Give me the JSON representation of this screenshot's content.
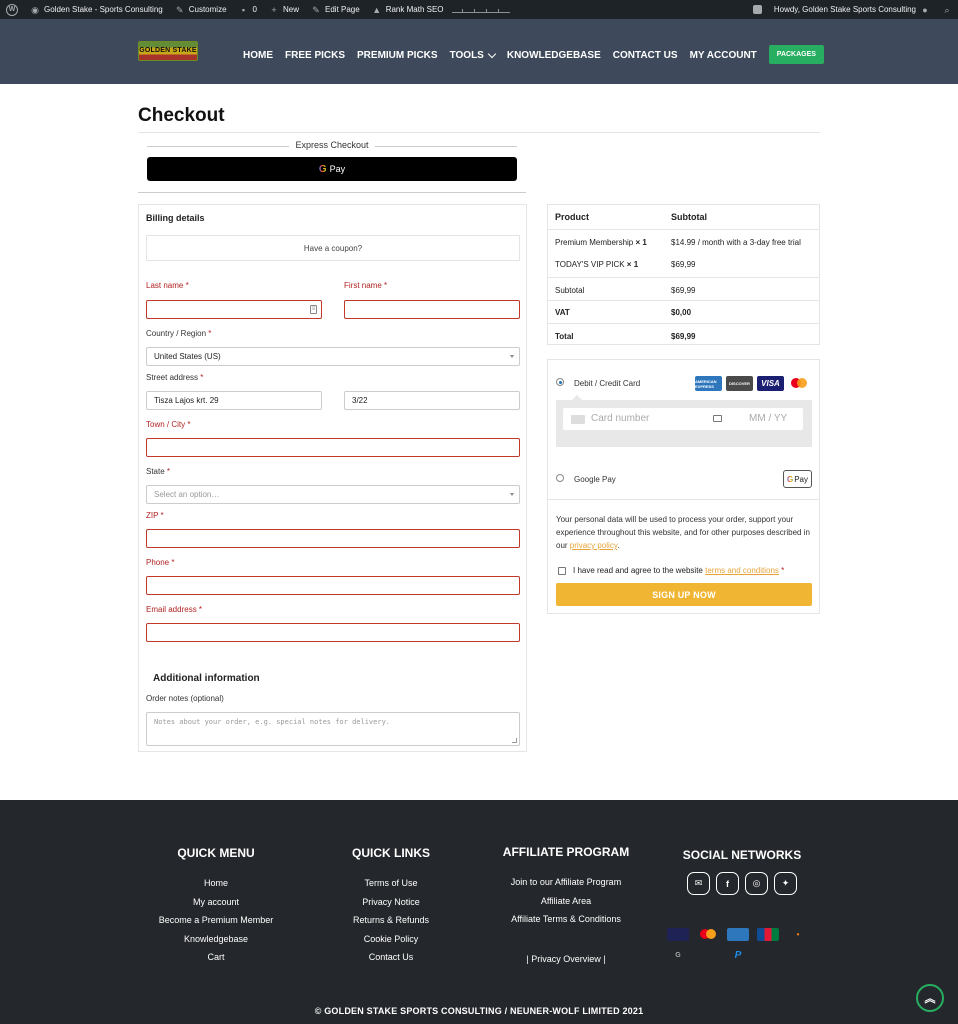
{
  "admin_bar": {
    "site_name": "Golden Stake - Sports Consulting",
    "customize": "Customize",
    "comments_count": "0",
    "new": "New",
    "edit_page": "Edit Page",
    "rank_math": "Rank Math SEO",
    "howdy": "Howdy, Golden Stake Sports Consulting"
  },
  "header": {
    "logo_text": "GOLDEN STAKE",
    "nav": [
      "HOME",
      "FREE PICKS",
      "PREMIUM PICKS",
      "TOOLS",
      "KNOWLEDGEBASE",
      "CONTACT US",
      "MY ACCOUNT"
    ],
    "packages": "PACKAGES"
  },
  "page": {
    "title": "Checkout",
    "express_checkout": "Express Checkout",
    "gpay_label": "Pay",
    "gpay_g": "G"
  },
  "billing": {
    "title": "Billing details",
    "coupon": "Have a coupon?",
    "req": "*",
    "last_name": "Last name",
    "first_name": "First name",
    "country_label": "Country / Region",
    "country_value": "United States (US)",
    "street_label": "Street address",
    "street_value": "Tisza Lajos krt. 29",
    "street2_value": "3/22",
    "city_label": "Town / City",
    "state_label": "State",
    "state_placeholder": "Select an option…",
    "zip_label": "ZIP",
    "phone_label": "Phone",
    "email_label": "Email address",
    "additional_title": "Additional information",
    "notes_label": "Order notes (optional)",
    "notes_placeholder": "Notes about your order, e.g. special notes for delivery."
  },
  "order": {
    "col_product": "Product",
    "col_subtotal": "Subtotal",
    "rows": [
      {
        "product": "Premium Membership",
        "qty": "× 1",
        "subtotal": "$14.99 / month with a 3-day free trial"
      },
      {
        "product": "TODAY'S VIP PICK",
        "qty": "× 1",
        "subtotal": "$69,99"
      }
    ],
    "subtotal_label": "Subtotal",
    "subtotal_value": "$69,99",
    "vat_label": "VAT",
    "vat_value": "$0,00",
    "total_label": "Total",
    "total_value": "$69,99"
  },
  "payment": {
    "card_option": "Debit / Credit Card",
    "card_brands": [
      "AMERICAN EXPRESS",
      "DISCOVER",
      "VISA",
      "mastercard"
    ],
    "card_number_placeholder": "Card number",
    "expiry_placeholder": "MM / YY",
    "gpay_option": "Google Pay",
    "gpay_badge": "Pay",
    "privacy_text": "Your personal data will be used to process your order, support your experience throughout this website, and for other purposes described in our",
    "privacy_link": "privacy policy",
    "terms_text": "I have read and agree to the website",
    "terms_link": "terms and conditions",
    "signup": "SIGN UP NOW"
  },
  "footer": {
    "quick_menu": {
      "title": "QUICK MENU",
      "items": [
        "Home",
        "My account",
        "Become a Premium Member",
        "Knowledgebase",
        "Cart"
      ]
    },
    "quick_links": {
      "title": "QUICK LINKS",
      "items": [
        "Terms of Use",
        "Privacy Notice",
        "Returns & Refunds",
        "Cookie Policy",
        "Contact Us"
      ]
    },
    "affiliate": {
      "title": "AFFILIATE PROGRAM",
      "items": [
        "Join to our Affiliate Program",
        "Affiliate Area",
        "Affiliate Terms & Conditions"
      ],
      "privacy": "| Privacy Overview |"
    },
    "social": {
      "title": "SOCIAL NETWORKS"
    },
    "copyright": "© GOLDEN STAKE SPORTS CONSULTING / NEUNER-WOLF LIMITED 2021"
  },
  "colors": {
    "header_bg": "#3e4a5b",
    "accent_green": "#27ae60",
    "signup_orange": "#f0b532",
    "footer_bg": "#24272b",
    "error_red": "#c0392b"
  }
}
